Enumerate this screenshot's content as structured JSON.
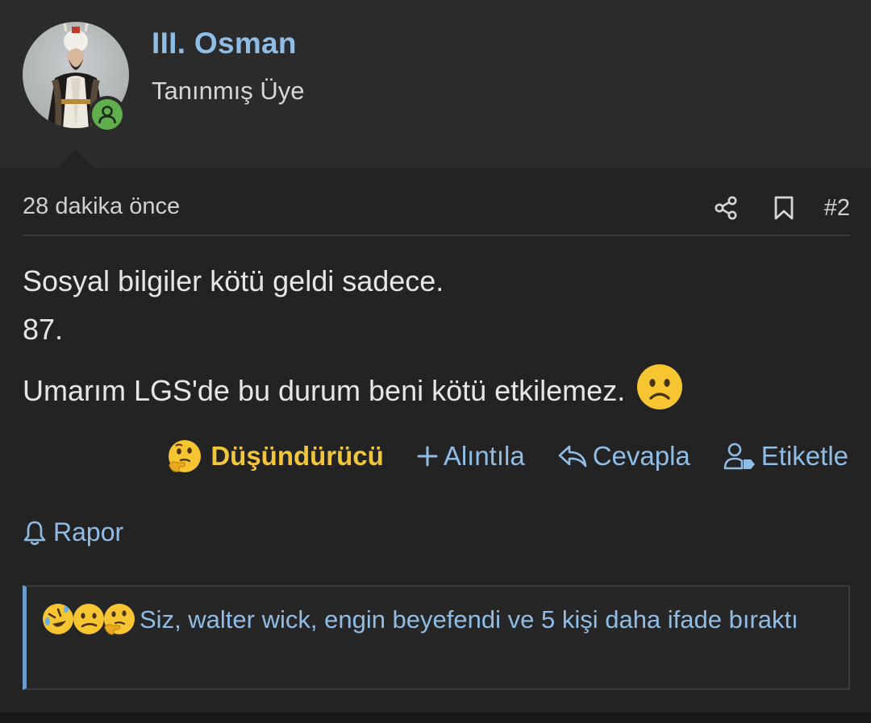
{
  "user": {
    "name": "III. Osman",
    "title": "Tanınmış Üye",
    "status": "online"
  },
  "post": {
    "time": "28 dakika önce",
    "number": "#2",
    "lines": [
      "Sosyal bilgiler kötü geldi sadece.",
      "87.",
      "Umarım LGS'de bu durum beni kötü etkilemez."
    ]
  },
  "actions": {
    "reaction_label": "Düşündürücü",
    "quote_label": "Alıntıla",
    "reply_label": "Cevapla",
    "tag_label": "Etiketle",
    "report_label": "Rapor"
  },
  "reactions_summary": {
    "text": "Siz, walter wick, engin beyefendi ve 5 kişi daha ifade bıraktı",
    "emojis": [
      "rofl-emoji",
      "confused-emoji",
      "thinking-emoji"
    ]
  },
  "colors": {
    "background": "#232324",
    "header": "#2b2b2c",
    "link": "#8fbde6",
    "reaction_selected": "#f2c63b",
    "online": "#5fb04c"
  }
}
